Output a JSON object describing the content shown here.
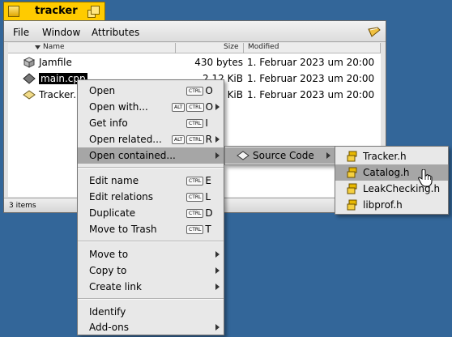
{
  "window": {
    "title": "tracker",
    "menubar": {
      "file": "File",
      "window": "Window",
      "attributes": "Attributes"
    },
    "columns": {
      "name": "Name",
      "size": "Size",
      "modified": "Modified"
    },
    "files": [
      {
        "name": "Jamfile",
        "size": "430 bytes",
        "modified": "1. Februar 2023 um 20:00",
        "icon": "makefile-icon"
      },
      {
        "name": "main.cpp",
        "size": "2.12 KiB",
        "modified": "1. Februar 2023 um 20:00",
        "icon": "source-file-icon"
      },
      {
        "name": "Tracker.",
        "size": "KiB",
        "modified": "1. Februar 2023 um 20:00",
        "icon": "resource-file-icon"
      }
    ],
    "status": "3 items"
  },
  "context_menu": {
    "items": {
      "open": {
        "label": "Open",
        "mods": [
          "CTRL"
        ],
        "key": "O"
      },
      "open_with": {
        "label": "Open with...",
        "mods": [
          "ALT",
          "CTRL"
        ],
        "key": "O"
      },
      "get_info": {
        "label": "Get info",
        "mods": [
          "CTRL"
        ],
        "key": "I"
      },
      "open_related": {
        "label": "Open related...",
        "mods": [
          "ALT",
          "CTRL"
        ],
        "key": "R"
      },
      "open_contained": {
        "label": "Open contained..."
      },
      "edit_name": {
        "label": "Edit name",
        "mods": [
          "CTRL"
        ],
        "key": "E"
      },
      "edit_relations": {
        "label": "Edit relations",
        "mods": [
          "CTRL"
        ],
        "key": "L"
      },
      "duplicate": {
        "label": "Duplicate",
        "mods": [
          "CTRL"
        ],
        "key": "D"
      },
      "move_to_trash": {
        "label": "Move to Trash",
        "mods": [
          "CTRL"
        ],
        "key": "T"
      },
      "move_to": {
        "label": "Move to"
      },
      "copy_to": {
        "label": "Copy to"
      },
      "create_link": {
        "label": "Create link"
      },
      "identify": {
        "label": "Identify"
      },
      "add_ons": {
        "label": "Add-ons"
      }
    }
  },
  "submenu_contained": {
    "source_code": "Source Code"
  },
  "submenu_source": {
    "items": [
      "Tracker.h",
      "Catalog.h",
      "LeakChecking.h",
      "libprof.h"
    ]
  },
  "colors": {
    "desktop": "#336699",
    "tab": "#ffcb00",
    "highlight": "#a6a6a6"
  }
}
